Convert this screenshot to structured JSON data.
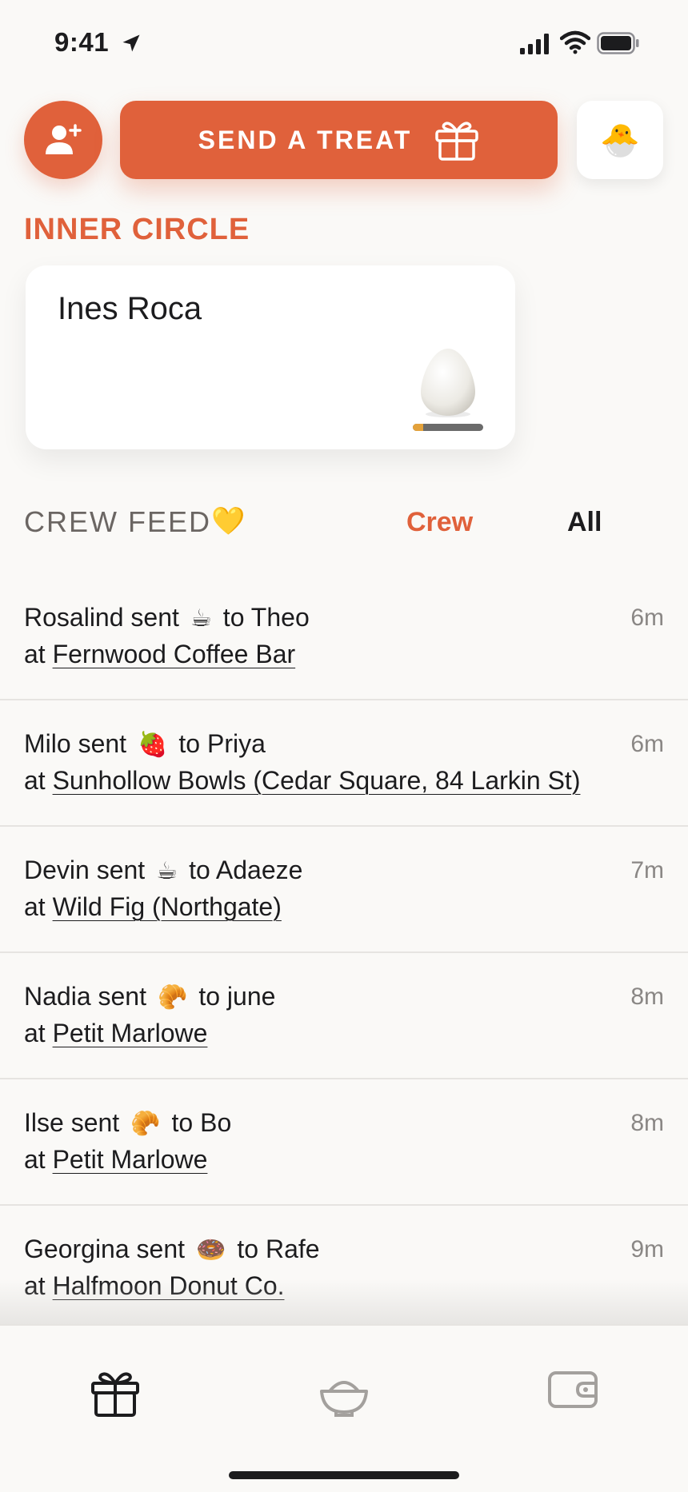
{
  "status_bar": {
    "time": "9:41"
  },
  "actions": {
    "send_treat_label": "SEND A TREAT",
    "profile_emoji": "🐣"
  },
  "inner_circle": {
    "title": "INNER CIRCLE",
    "friends": [
      {
        "name": "Ines Roca",
        "progress": 0.15
      }
    ]
  },
  "feed": {
    "title": "CREW FEED",
    "heart": "💛",
    "tabs": [
      {
        "label": "Crew",
        "active": true
      },
      {
        "label": "All",
        "active": false
      }
    ],
    "items": [
      {
        "sender": "Rosalind sent",
        "treat": "☕",
        "recipient": "to Theo",
        "at": "at",
        "place": "Fernwood Coffee Bar",
        "time": "6m"
      },
      {
        "sender": "Milo sent",
        "treat": "🍓",
        "recipient": "to Priya",
        "at": "at",
        "place": "Sunhollow Bowls (Cedar Square, 84 Larkin St)",
        "time": "6m"
      },
      {
        "sender": "Devin sent",
        "treat": "☕",
        "recipient": "to Adaeze",
        "at": "at",
        "place": "Wild Fig (Northgate)",
        "time": "7m"
      },
      {
        "sender": "Nadia sent",
        "treat": "🥐",
        "recipient": "to june",
        "at": "at",
        "place": "Petit Marlowe",
        "time": "8m"
      },
      {
        "sender": "Ilse sent",
        "treat": "🥐",
        "recipient": "to Bo",
        "at": "at",
        "place": "Petit Marlowe",
        "time": "8m"
      },
      {
        "sender": "Georgina sent",
        "treat": "🍩",
        "recipient": "to Rafe",
        "at": "at",
        "place": "Halfmoon Donut Co.",
        "time": "9m"
      }
    ]
  },
  "tab_bar": {
    "items": [
      {
        "icon": "gift-icon",
        "active": true
      },
      {
        "icon": "bowl-icon",
        "active": false
      },
      {
        "icon": "wallet-icon",
        "active": false
      }
    ]
  },
  "colors": {
    "accent": "#e0613b",
    "background": "#faf9f7",
    "text": "#1c1c1e",
    "muted": "#8a8785"
  }
}
